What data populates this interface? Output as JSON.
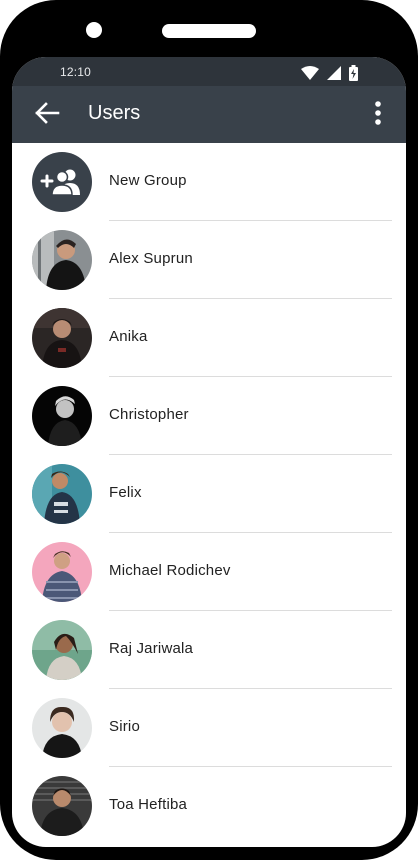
{
  "status_bar": {
    "time": "12:10",
    "icons": [
      "wifi-icon",
      "signal-icon",
      "battery-charging-icon"
    ]
  },
  "app_bar": {
    "title": "Users",
    "back_icon": "arrow-left-icon",
    "menu_icon": "more-vertical-icon"
  },
  "list": {
    "new_group": {
      "label": "New Group",
      "icon": "add-group-icon"
    },
    "users": [
      {
        "name": "Alex Suprun"
      },
      {
        "name": "Anika"
      },
      {
        "name": "Christopher"
      },
      {
        "name": "Felix"
      },
      {
        "name": "Michael Rodichev"
      },
      {
        "name": "Raj Jariwala"
      },
      {
        "name": "Sirio"
      },
      {
        "name": "Toa Heftiba"
      }
    ]
  },
  "colors": {
    "app_bar": "#39414a",
    "status_bar": "#2e343b",
    "divider": "#dcdcdc",
    "text": "#222222"
  }
}
